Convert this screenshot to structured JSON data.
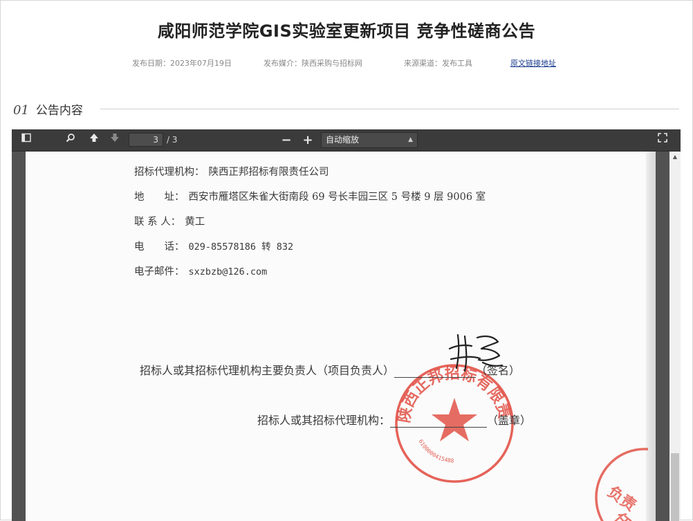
{
  "header": {
    "title": "咸阳师范学院GIS实验室更新项目 竞争性磋商公告",
    "publish_date": "发布日期：2023年07月19日",
    "media": "发布媒介：陕西采购与招标网",
    "source": "来源渠道：发布工具",
    "original_link": "原文链接地址"
  },
  "section": {
    "number": "01",
    "title": "公告内容"
  },
  "viewer": {
    "current_page": "3",
    "page_total": "/ 3",
    "zoom": "自动缩放",
    "icons": {
      "sidebar": "sidebar-toggle-icon",
      "find": "search-icon",
      "prev": "arrow-up-icon",
      "next": "arrow-down-icon",
      "zoom_out": "minus-icon",
      "zoom_in": "plus-icon",
      "fullscreen": "fullscreen-icon"
    }
  },
  "document": {
    "agency": {
      "label": "招标代理机构：",
      "value": "陕西正邦招标有限责任公司"
    },
    "address": {
      "label": "地　　址：",
      "value": "西安市雁塔区朱雀大街南段 69 号长丰园三区 5 号楼 9 层 9006 室"
    },
    "contact": {
      "label": "联 系 人：",
      "value": "黄工"
    },
    "phone": {
      "label": "电　　话：",
      "value": "029-85578186 转 832"
    },
    "email": {
      "label": "电子邮件：",
      "value": "sxzbzb@126.com"
    },
    "sign_line": {
      "text": "招标人或其招标代理机构主要负责人（项目负责人）",
      "suffix": "（签名）"
    },
    "seal_line": {
      "text": "招标人或其招标代理机构：",
      "suffix": "（盖章）"
    },
    "seal": {
      "text": "陕西正邦招标有限责任公司",
      "code": "6100000415488",
      "color": "#e0483c"
    },
    "signature": "黄志"
  }
}
